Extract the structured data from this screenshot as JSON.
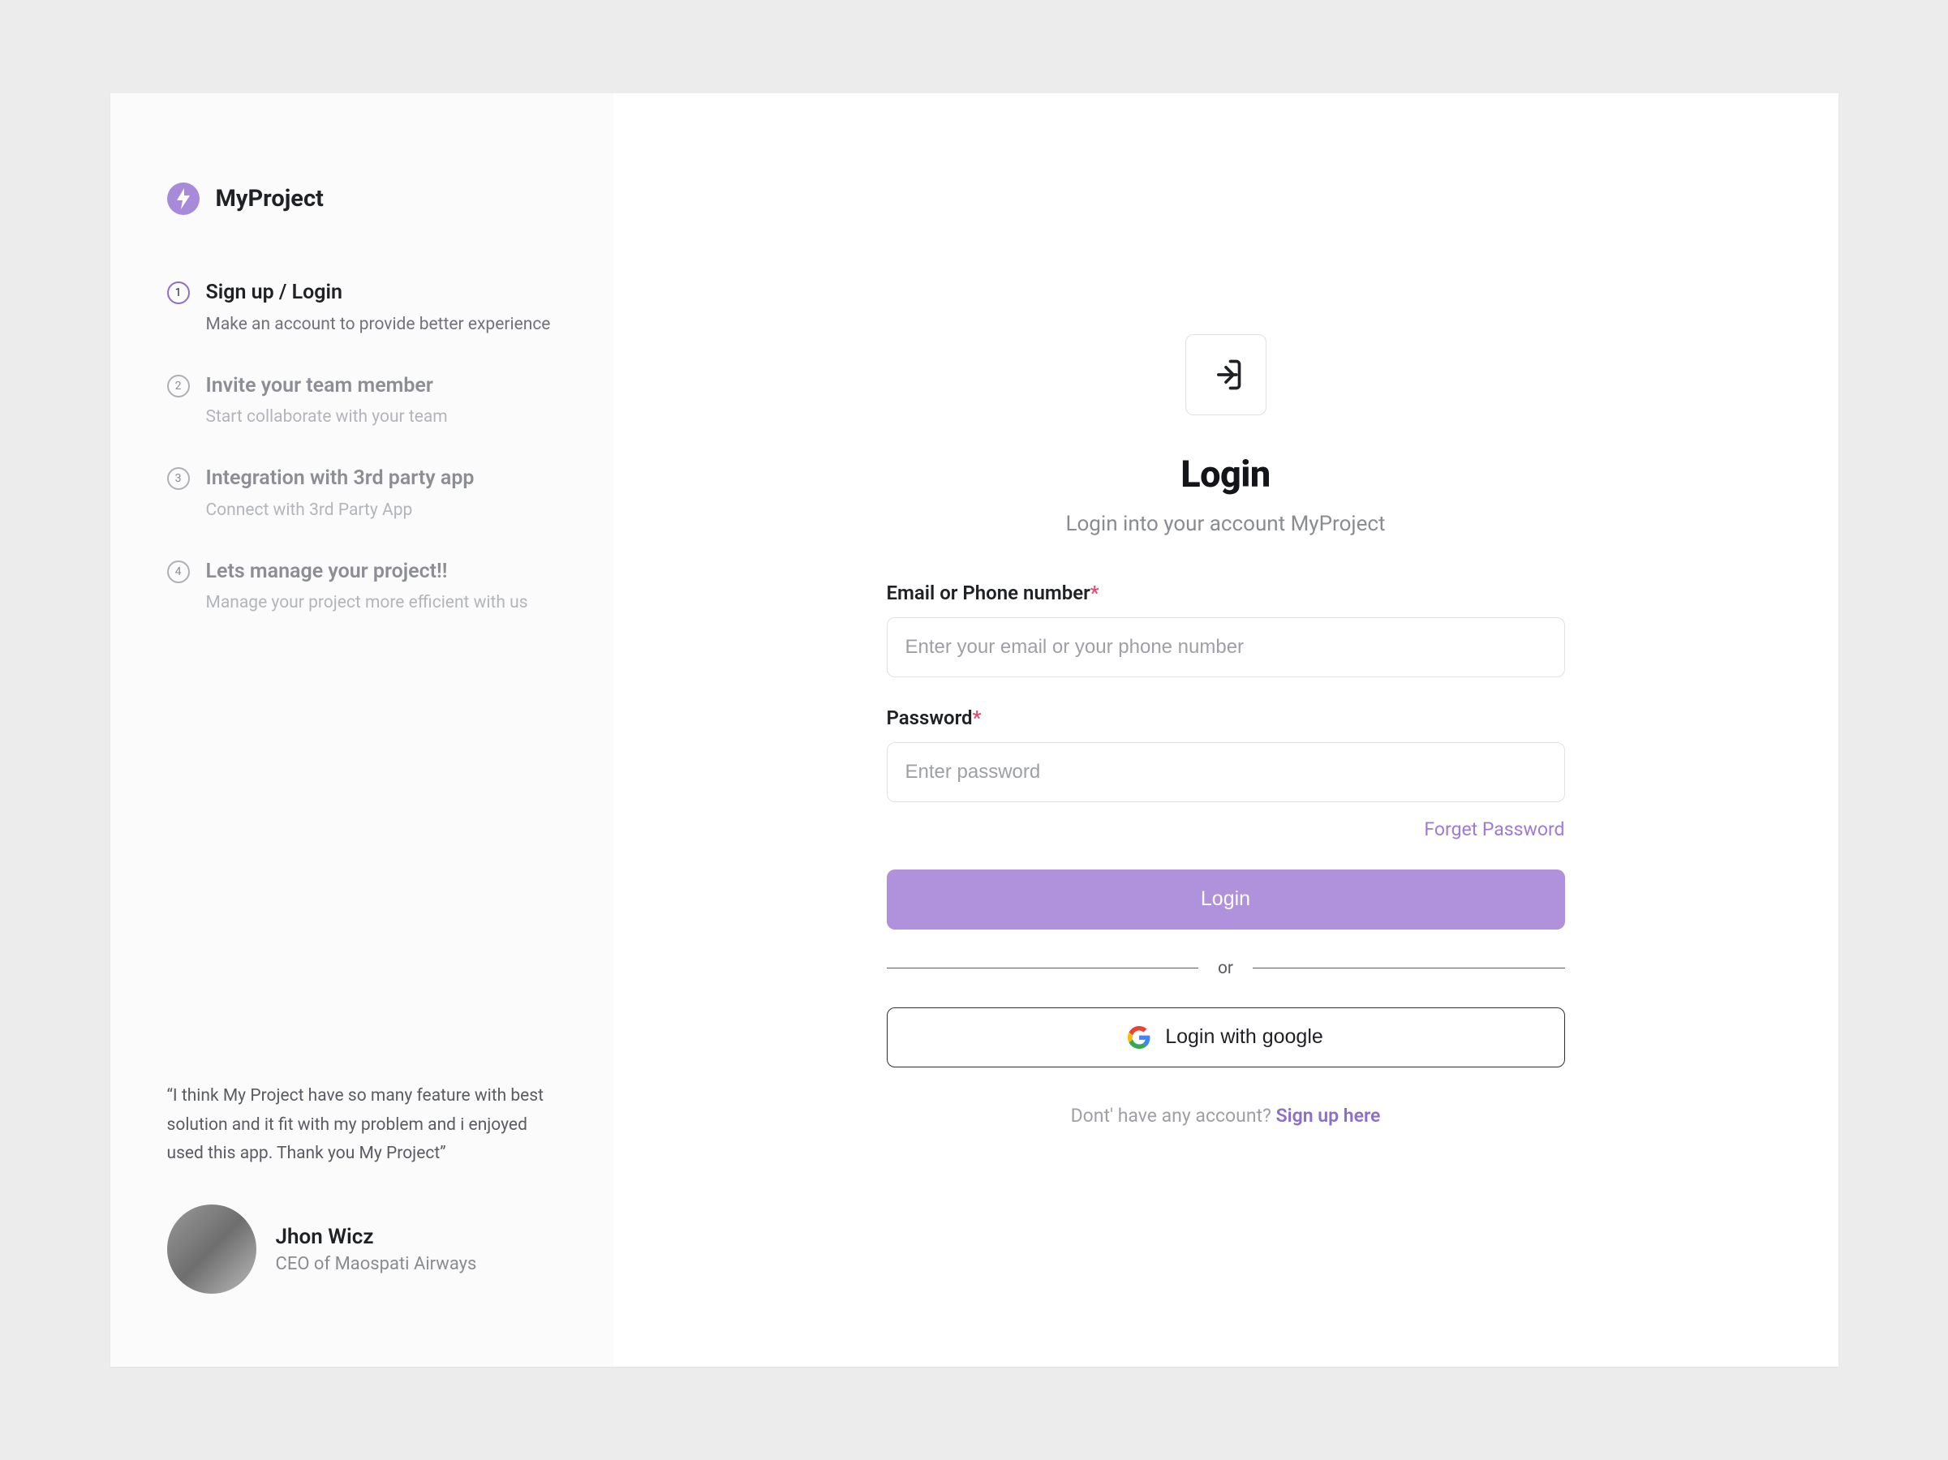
{
  "brand": {
    "name": "MyProject"
  },
  "steps": [
    {
      "num": "1",
      "title": "Sign up / Login",
      "sub": "Make an account to provide better experience"
    },
    {
      "num": "2",
      "title": "Invite your team member",
      "sub": "Start collaborate with your team"
    },
    {
      "num": "3",
      "title": "Integration with 3rd party app",
      "sub": "Connect with 3rd Party App"
    },
    {
      "num": "4",
      "title": "Lets manage your project!!",
      "sub": "Manage your project more efficient with us"
    }
  ],
  "testimonial": {
    "quote": "“I think My Project have so many feature with best solution and it fit with my problem and i enjoyed used this app. Thank you My Project”",
    "author": "Jhon Wicz",
    "role": "CEO of Maospati Airways"
  },
  "login": {
    "title": "Login",
    "subtitle": "Login into your account MyProject",
    "email_label": "Email or Phone number",
    "email_placeholder": "Enter your email or your phone number",
    "password_label": "Password",
    "password_placeholder": "Enter password",
    "required_mark": "*",
    "forgot": "Forget Password",
    "submit": "Login",
    "or": "or",
    "google": "Login with google",
    "footer_q": "Dont' have any account? ",
    "footer_link": "Sign up here"
  }
}
